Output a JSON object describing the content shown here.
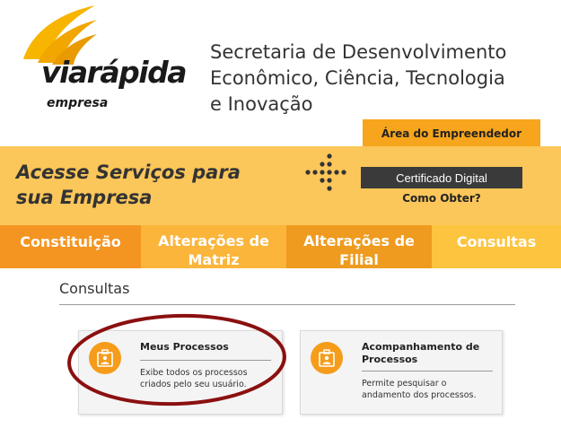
{
  "logo": {
    "text": "viarápida empresa",
    "colors": {
      "swoosh_top": "#f7b500",
      "swoosh_bottom": "#e8a000",
      "text": "#1a1a1a"
    }
  },
  "header": {
    "secretaria_line1": "Secretaria de Desenvolvimento",
    "secretaria_line2": "Econômico, Ciência, Tecnologia",
    "secretaria_line3": "e Inovação",
    "area_tab": "Área do Empreendedor"
  },
  "banner": {
    "title_line1": "Acesse Serviços para",
    "title_line2": "sua Empresa",
    "cert_button": "Certificado Digital",
    "como_obter": "Como Obter?",
    "dots_icon": "dots-pattern-icon"
  },
  "nav": {
    "items": [
      {
        "line1": "Constituição",
        "line2": ""
      },
      {
        "line1": "Alterações de",
        "line2": "Matriz"
      },
      {
        "line1": "Alterações de",
        "line2": "Filial"
      },
      {
        "line1": "Consultas",
        "line2": ""
      }
    ]
  },
  "content": {
    "section_title": "Consultas",
    "cards": [
      {
        "title": "Meus Processos",
        "description_line1": "Exibe todos os processos",
        "description_line2": "criados pelo seu usuário.",
        "icon": "id-card-icon"
      },
      {
        "title_line1": "Acompanhamento de",
        "title_line2": "Processos",
        "description_line1": "Permite pesquisar o",
        "description_line2": "andamento dos processos.",
        "icon": "id-card-icon"
      }
    ]
  },
  "colors": {
    "accent": "#f59c1a",
    "banner": "#fbc65a",
    "highlight_ellipse": "#8b1010"
  }
}
